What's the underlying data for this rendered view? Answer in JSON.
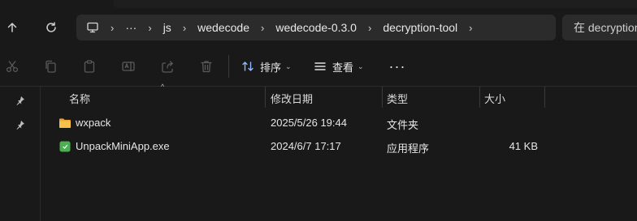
{
  "address": {
    "segments": [
      "js",
      "wedecode",
      "wedecode-0.3.0",
      "decryption-tool"
    ],
    "overflow_label": "···"
  },
  "search": {
    "placeholder": "在 decryption"
  },
  "toolbar": {
    "sort_label": "排序",
    "view_label": "查看",
    "more_label": "···"
  },
  "columns": {
    "name": "名称",
    "modified": "修改日期",
    "type": "类型",
    "size": "大小"
  },
  "files": [
    {
      "name": "wxpack",
      "modified": "2025/5/26 19:44",
      "type": "文件夹",
      "size": "",
      "icon": "folder-icon"
    },
    {
      "name": "UnpackMiniApp.exe",
      "modified": "2024/6/7 17:17",
      "type": "应用程序",
      "size": "41 KB",
      "icon": "exe-app-icon"
    }
  ],
  "colors": {
    "background": "#191919",
    "bar": "#2b2b2b",
    "folder": "#f7c04a",
    "exe": "#4caf50"
  }
}
